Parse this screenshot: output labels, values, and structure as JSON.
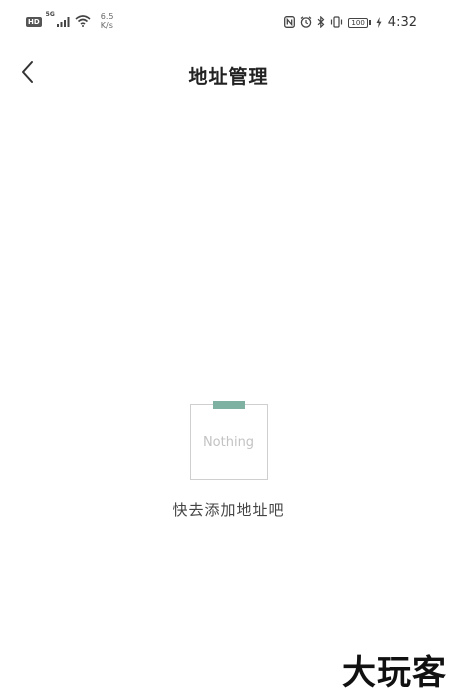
{
  "status_bar": {
    "hd_label": "HD",
    "network_gen": "5G",
    "speed_value": "6.5",
    "speed_unit": "K/s",
    "battery": "100",
    "time": "4:32"
  },
  "nav": {
    "title": "地址管理",
    "back_icon": "chevron-left-icon"
  },
  "empty_state": {
    "illustration_text": "Nothing",
    "message": "快去添加地址吧",
    "tape_color": "#7fb1a2"
  },
  "watermark": {
    "text": "大玩客"
  }
}
